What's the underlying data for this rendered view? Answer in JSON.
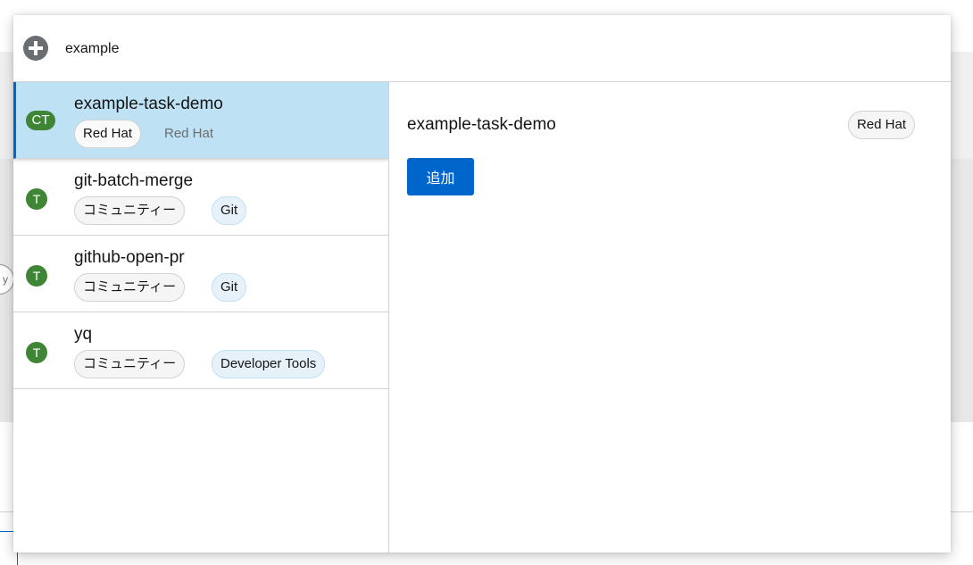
{
  "search": {
    "value": "example",
    "placeholder": ""
  },
  "results": [
    {
      "badge": "CT",
      "title": "example-task-demo",
      "provider": "Red Hat",
      "secondary": "Red Hat",
      "selected": true
    },
    {
      "badge": "T",
      "title": "git-batch-merge",
      "provider": "コミュニティー",
      "category": "Git",
      "selected": false
    },
    {
      "badge": "T",
      "title": "github-open-pr",
      "provider": "コミュニティー",
      "category": "Git",
      "selected": false
    },
    {
      "badge": "T",
      "title": "yq",
      "provider": "コミュニティー",
      "category": "Developer Tools",
      "selected": false
    }
  ],
  "details": {
    "title": "example-task-demo",
    "provider": "Red Hat",
    "add_label": "追加"
  },
  "background": {
    "chip_text": "y"
  },
  "colors": {
    "accent": "#0066cc",
    "selected_bg": "#bee1f4",
    "badge_green": "#3e8635"
  }
}
